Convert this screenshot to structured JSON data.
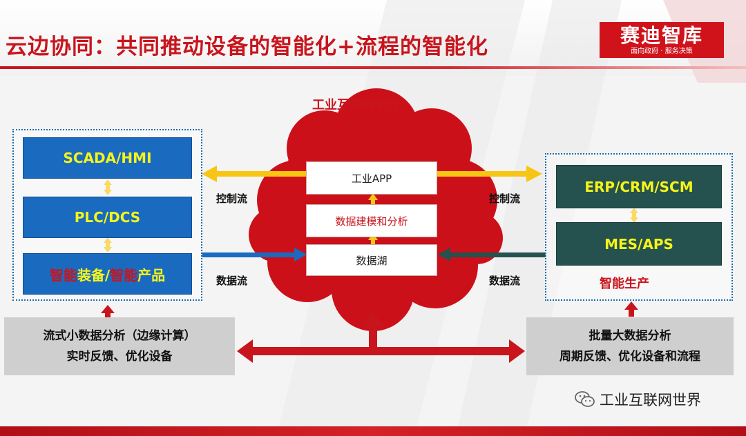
{
  "header": {
    "title": "云边协同：共同推动设备的智能化+流程的智能化",
    "logo_name": "赛迪智库",
    "logo_slogan": "面向政府 · 服务决策"
  },
  "platform": {
    "title": "工业互联网平台",
    "layers": [
      "工业APP",
      "数据建模和分析",
      "数据湖"
    ]
  },
  "left": {
    "boxes": [
      "SCADA/HMI",
      "PLC/DCS"
    ],
    "product_box": [
      {
        "text": "智能",
        "tone": "red"
      },
      {
        "text": "装备/",
        "tone": "yellow"
      },
      {
        "text": "智能",
        "tone": "red"
      },
      {
        "text": " 产品",
        "tone": "yellow"
      }
    ],
    "control_flow": "控制流",
    "data_flow": "数据流",
    "analysis_lines": [
      "流式小数据分析（边缘计算）",
      "实时反馈、优化设备"
    ]
  },
  "right": {
    "boxes": [
      "ERP/CRM/SCM",
      "MES/APS"
    ],
    "caption": "智能生产",
    "control_flow": "控制流",
    "data_flow": "数据流",
    "analysis_lines": [
      "批量大数据分析",
      "周期反馈、优化设备和流程"
    ]
  },
  "watermark": "工业互联网世界",
  "colors": {
    "brand_red": "#c8151d",
    "box_blue": "#1a6ac0",
    "box_dark": "#25514e",
    "box_text_yellow": "#f5f51a",
    "arrow_yellow": "#f7c514",
    "arrow_blue": "#1a6ac0",
    "arrow_dark": "#25514e",
    "arrow_red": "#c8151d",
    "gray_panel": "#cfcfcf"
  }
}
